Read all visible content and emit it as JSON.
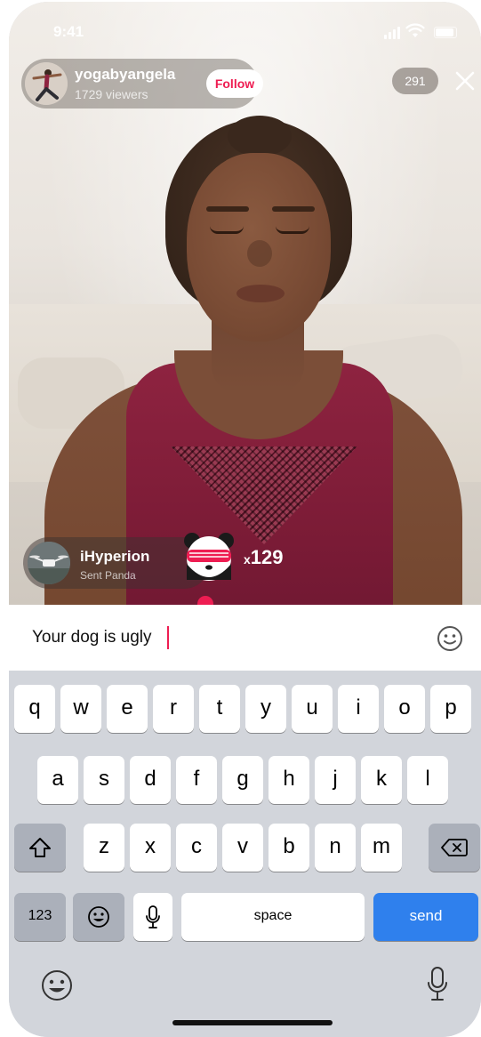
{
  "status_bar": {
    "time": "9:41"
  },
  "host": {
    "username": "yogabyangela",
    "viewers": "1729 viewers",
    "follow_label": "Follow"
  },
  "viewer_count": "291",
  "gift": {
    "sender": "iHyperion",
    "subtitle": "Sent Panda",
    "multiplier_prefix": "x",
    "multiplier_value": "129"
  },
  "comment_input": {
    "value": "Your dog is ugly"
  },
  "keyboard": {
    "row1": [
      "q",
      "w",
      "e",
      "r",
      "t",
      "y",
      "u",
      "i",
      "o",
      "p"
    ],
    "row2": [
      "a",
      "s",
      "d",
      "f",
      "g",
      "h",
      "j",
      "k",
      "l"
    ],
    "row3": [
      "z",
      "x",
      "c",
      "v",
      "b",
      "n",
      "m"
    ],
    "numbers_label": "123",
    "space_label": "space",
    "send_label": "send"
  },
  "colors": {
    "accent": "#ee1d52",
    "send_key": "#2f80ed",
    "keyboard_bg": "#d2d5db",
    "top_color": "#8e2340"
  },
  "icons": [
    "signal-icon",
    "wifi-icon",
    "battery-icon",
    "close-icon",
    "emoji-icon",
    "shift-icon",
    "backspace-icon",
    "microphone-icon",
    "panda-gift-icon"
  ]
}
